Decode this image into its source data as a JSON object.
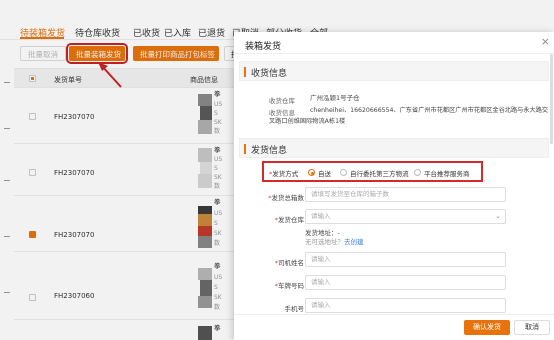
{
  "tabs": [
    {
      "label": "待装箱发货",
      "active": true
    },
    {
      "label": "待仓库收货",
      "active": false
    },
    {
      "label": "已收货",
      "active": false
    },
    {
      "label": "已入库",
      "active": false
    },
    {
      "label": "已退货",
      "active": false
    },
    {
      "label": "已取消",
      "active": false
    },
    {
      "label": "部分收货",
      "active": false
    },
    {
      "label": "全部",
      "active": false
    }
  ],
  "toolbar": {
    "batch_cancel": "批量取消",
    "batch_ship": "批量装箱发货",
    "batch_print": "批量打印商品打包标签",
    "more": "批"
  },
  "table": {
    "headers": {
      "order_no": "发货单号",
      "product_info": "商品信息"
    },
    "rows": [
      {
        "order_no": "FH2307070",
        "checked": false,
        "lines": [
          "拳",
          "US",
          "S",
          "SK",
          "数"
        ]
      },
      {
        "order_no": "FH2307070",
        "checked": false,
        "lines": [
          "拳",
          "US",
          "S",
          "SK",
          "数"
        ]
      },
      {
        "order_no": "FH2307070",
        "checked": true,
        "lines": [
          "拳",
          "US",
          "S",
          "SK",
          "数"
        ]
      },
      {
        "order_no": "FH2307060",
        "checked": false,
        "lines": [
          "拳",
          "US",
          "S",
          "SK",
          "数"
        ]
      },
      {
        "order_no": "",
        "checked": false,
        "lines": [
          "拳"
        ]
      }
    ]
  },
  "modal": {
    "title": "装箱发货",
    "close": "×",
    "receiving_section": {
      "title": "收货信息",
      "warehouse_label": "收货仓库",
      "warehouse_value": "广州泓颖1号子仓",
      "info_label": "收货信息",
      "info_line1": "chenheihei、16620666554、广东省广州市花都区广州市花都区金谷北路与永大路交",
      "info_line2": "叉路口创维国际物流A栋1楼"
    },
    "shipping_section": {
      "title": "发货信息",
      "method_label": "发货方式",
      "methods": [
        {
          "label": "自送",
          "selected": true
        },
        {
          "label": "自行委托第三方物流",
          "selected": false
        },
        {
          "label": "平台推荐服务商",
          "selected": false
        }
      ],
      "total_boxes_label": "发货总箱数",
      "total_boxes_placeholder": "请填写发货至仓库的箱子数",
      "warehouse_label": "发货仓库",
      "warehouse_placeholder": "请输入",
      "address_label": "发货地址：-",
      "address_hint_prefix": "无可选地址？",
      "address_hint_link": "去创建",
      "driver_label": "司机姓名",
      "driver_placeholder": "请输入",
      "plate_label": "车牌号码",
      "plate_placeholder": "请输入",
      "phone_label": "手机号",
      "phone_placeholder": "请输入"
    },
    "confirm_button": "确认发货",
    "cancel_button": "取消"
  },
  "colors": {
    "accent": "#e8730c",
    "highlight_red": "#d42a2a",
    "link": "#3a7bd5"
  }
}
